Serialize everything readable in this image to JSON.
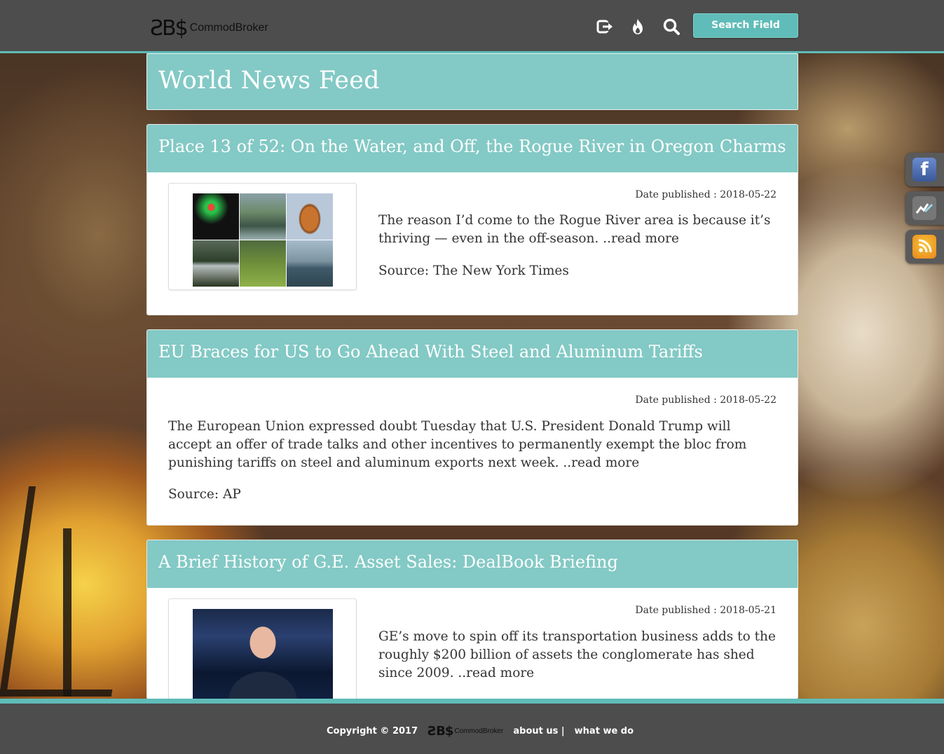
{
  "header": {
    "logo_mark": "ƧB$",
    "logo_text": "CommodBroker",
    "icons": [
      "logout-icon",
      "fire-icon",
      "search-icon"
    ],
    "search_button_label": "Search Field"
  },
  "page_title": "World News Feed",
  "articles": [
    {
      "title": "Place 13 of 52: On the Water, and Off, the Rogue River in Oregon Charms",
      "date": "Date published : 2018-05-22",
      "description": "The reason I’d come to the Rogue River area is because it’s thriving — even in the off-season. ..read more",
      "source": "Source: The New York Times"
    },
    {
      "title": "EU Braces for US to Go Ahead With Steel and Aluminum Tariffs",
      "date": "Date published : 2018-05-22",
      "description": "The European Union expressed doubt Tuesday that U.S. President Donald Trump will accept an offer of trade talks and other incentives to permanently exempt the bloc from punishing tariffs on steel and aluminum exports next week. ..read more",
      "source": "Source: AP"
    },
    {
      "title": "A Brief History of G.E. Asset Sales: DealBook Briefing",
      "date": "Date published : 2018-05-21",
      "description": "GE’s move to spin off its transportation business adds to the roughly $200 billion of assets the conglomerate has shed since 2009. ..read more",
      "source": ""
    }
  ],
  "social": {
    "facebook_glyph": "f",
    "tradingview_glyph": "⟋",
    "rss_glyph": "☉"
  },
  "footer": {
    "copyright": "Copyright © 2017",
    "logo_mark": "ƧB$",
    "logo_text": "CommodBroker",
    "about_link": "about us |",
    "whatwedo_link": "what we do"
  },
  "colors": {
    "accent": "#83c9c5",
    "header_bg": "#4d4d4d",
    "border_accent": "#5fbcb8"
  }
}
